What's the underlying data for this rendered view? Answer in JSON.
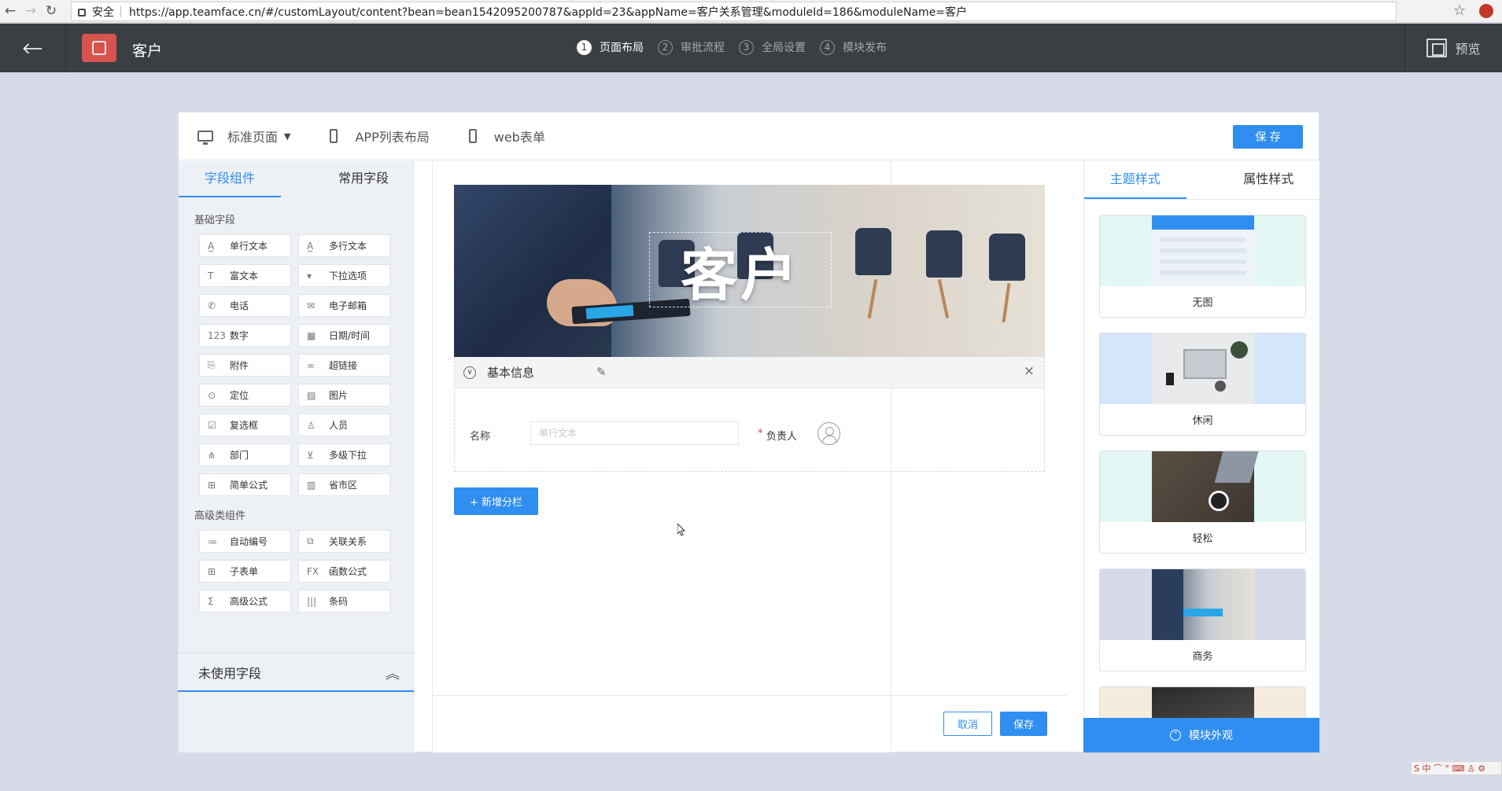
{
  "browser": {
    "secure_label": "安全",
    "url": "https://app.teamface.cn/#/customLayout/content?bean=bean1542095200787&appId=23&appName=客户关系管理&moduleId=186&moduleName=客户"
  },
  "header": {
    "title": "客户",
    "steps": [
      {
        "num": "1",
        "label": "页面布局"
      },
      {
        "num": "2",
        "label": "审批流程"
      },
      {
        "num": "3",
        "label": "全局设置"
      },
      {
        "num": "4",
        "label": "模块发布"
      }
    ],
    "preview_label": "预览"
  },
  "toolbar": {
    "standard_page": "标准页面",
    "app_list_layout": "APP列表布局",
    "web_form": "web表单",
    "save_label": "保 存"
  },
  "left": {
    "tabs": [
      "字段组件",
      "常用字段"
    ],
    "basic_title": "基础字段",
    "basic": [
      {
        "icon": "A̲",
        "label": "单行文本"
      },
      {
        "icon": "A̲",
        "label": "多行文本"
      },
      {
        "icon": "T",
        "label": "富文本"
      },
      {
        "icon": "▾",
        "label": "下拉选项"
      },
      {
        "icon": "✆",
        "label": "电话"
      },
      {
        "icon": "✉",
        "label": "电子邮箱"
      },
      {
        "icon": "123",
        "label": "数字"
      },
      {
        "icon": "▦",
        "label": "日期/时间"
      },
      {
        "icon": "⎘",
        "label": "附件"
      },
      {
        "icon": "∞",
        "label": "超链接"
      },
      {
        "icon": "⊙",
        "label": "定位"
      },
      {
        "icon": "▨",
        "label": "图片"
      },
      {
        "icon": "☑",
        "label": "复选框"
      },
      {
        "icon": "♙",
        "label": "人员"
      },
      {
        "icon": "⋔",
        "label": "部门"
      },
      {
        "icon": "⊻",
        "label": "多级下拉"
      },
      {
        "icon": "⊞",
        "label": "简单公式"
      },
      {
        "icon": "▥",
        "label": "省市区"
      }
    ],
    "advanced_title": "高级类组件",
    "advanced": [
      {
        "icon": "≔",
        "label": "自动编号"
      },
      {
        "icon": "⧉",
        "label": "关联关系"
      },
      {
        "icon": "⊞",
        "label": "子表单"
      },
      {
        "icon": "FX",
        "label": "函数公式"
      },
      {
        "icon": "Σ",
        "label": "高级公式"
      },
      {
        "icon": "|||",
        "label": "条码"
      }
    ],
    "unused_label": "未使用字段"
  },
  "canvas": {
    "banner_title": "客户",
    "section_title": "基本信息",
    "field_name_label": "名称",
    "field_name_placeholder": "单行文本",
    "required_mark": "*",
    "owner_label": "负责人",
    "add_column_label": "+ 新增分栏",
    "cancel_label": "取消",
    "save_label": "保存"
  },
  "right": {
    "tabs": [
      "主题样式",
      "属性样式"
    ],
    "themes": [
      "无图",
      "休闲",
      "轻松",
      "商务"
    ],
    "appearance_label": "模块外观"
  },
  "colors": {
    "primary": "#2f8ef0",
    "header_bg": "#3a3f44",
    "page_bg": "#d7dbe9"
  }
}
